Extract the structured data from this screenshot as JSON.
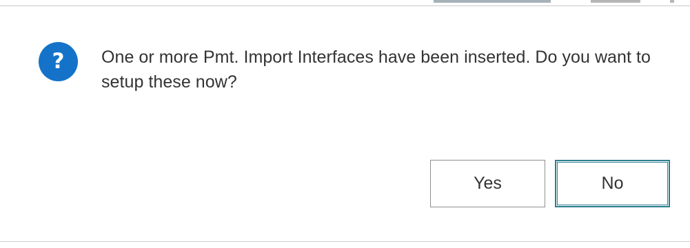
{
  "dialog": {
    "icon": "question-icon",
    "icon_glyph": "?",
    "message": "One or more Pmt. Import Interfaces have been inserted. Do you want to setup these now?",
    "buttons": {
      "yes_label": "Yes",
      "no_label": "No"
    }
  },
  "colors": {
    "icon_background": "#1473C9",
    "text": "#333333",
    "default_button_border": "#2C7D8F",
    "button_border": "#8F8F8F"
  }
}
